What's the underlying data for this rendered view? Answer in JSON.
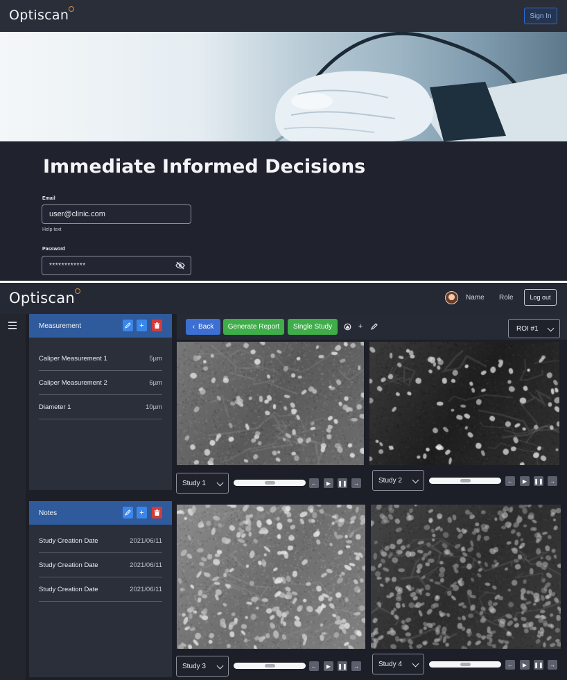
{
  "landing": {
    "logo_text_main": "Opti",
    "logo_text_accent": "scan",
    "signin_label": "Sign In",
    "headline": "Immediate Informed Decisions",
    "email_label": "Email",
    "email_value": "user@clinic.com",
    "email_help": "Help text",
    "password_label": "Password",
    "password_value": "************",
    "hero_image_icon": "gloved-hand-with-probe-image"
  },
  "app": {
    "logo_text_main": "Opti",
    "logo_text_accent": "scan",
    "user_name": "Name",
    "user_role": "Role",
    "logout_label": "Log out",
    "toolbar": {
      "back_label": "Back",
      "report_label": "Generate Report",
      "single_label": "Single Study",
      "roi_value": "ROI #1"
    },
    "measurement_panel": {
      "title": "Measurement",
      "items": [
        {
          "label": "Caliper Measurement 1",
          "value": "5µm"
        },
        {
          "label": "Caliper Measurement 2",
          "value": "6µm"
        },
        {
          "label": "Diameter 1",
          "value": "10µm"
        }
      ]
    },
    "notes_panel": {
      "title": "Notes",
      "items": [
        {
          "label": "Study Creation Date",
          "value": "2021/06/11"
        },
        {
          "label": "Study Creation Date",
          "value": "2021/06/11"
        },
        {
          "label": "Study Creation Date",
          "value": "2021/06/11"
        }
      ]
    },
    "viewers": [
      {
        "study": "Study 1",
        "progress": 0.5
      },
      {
        "study": "Study 2",
        "progress": 0.5
      },
      {
        "study": "Study 3",
        "progress": 0.5
      },
      {
        "study": "Study 4",
        "progress": 0.5
      }
    ]
  },
  "colors": {
    "background": "#1c1f28",
    "panel_header": "#2f5a9c",
    "primary_button": "#3d6fd2",
    "success_button": "#3fae4a",
    "danger_button": "#d43a3a",
    "logo_ring": "#d9913b"
  }
}
